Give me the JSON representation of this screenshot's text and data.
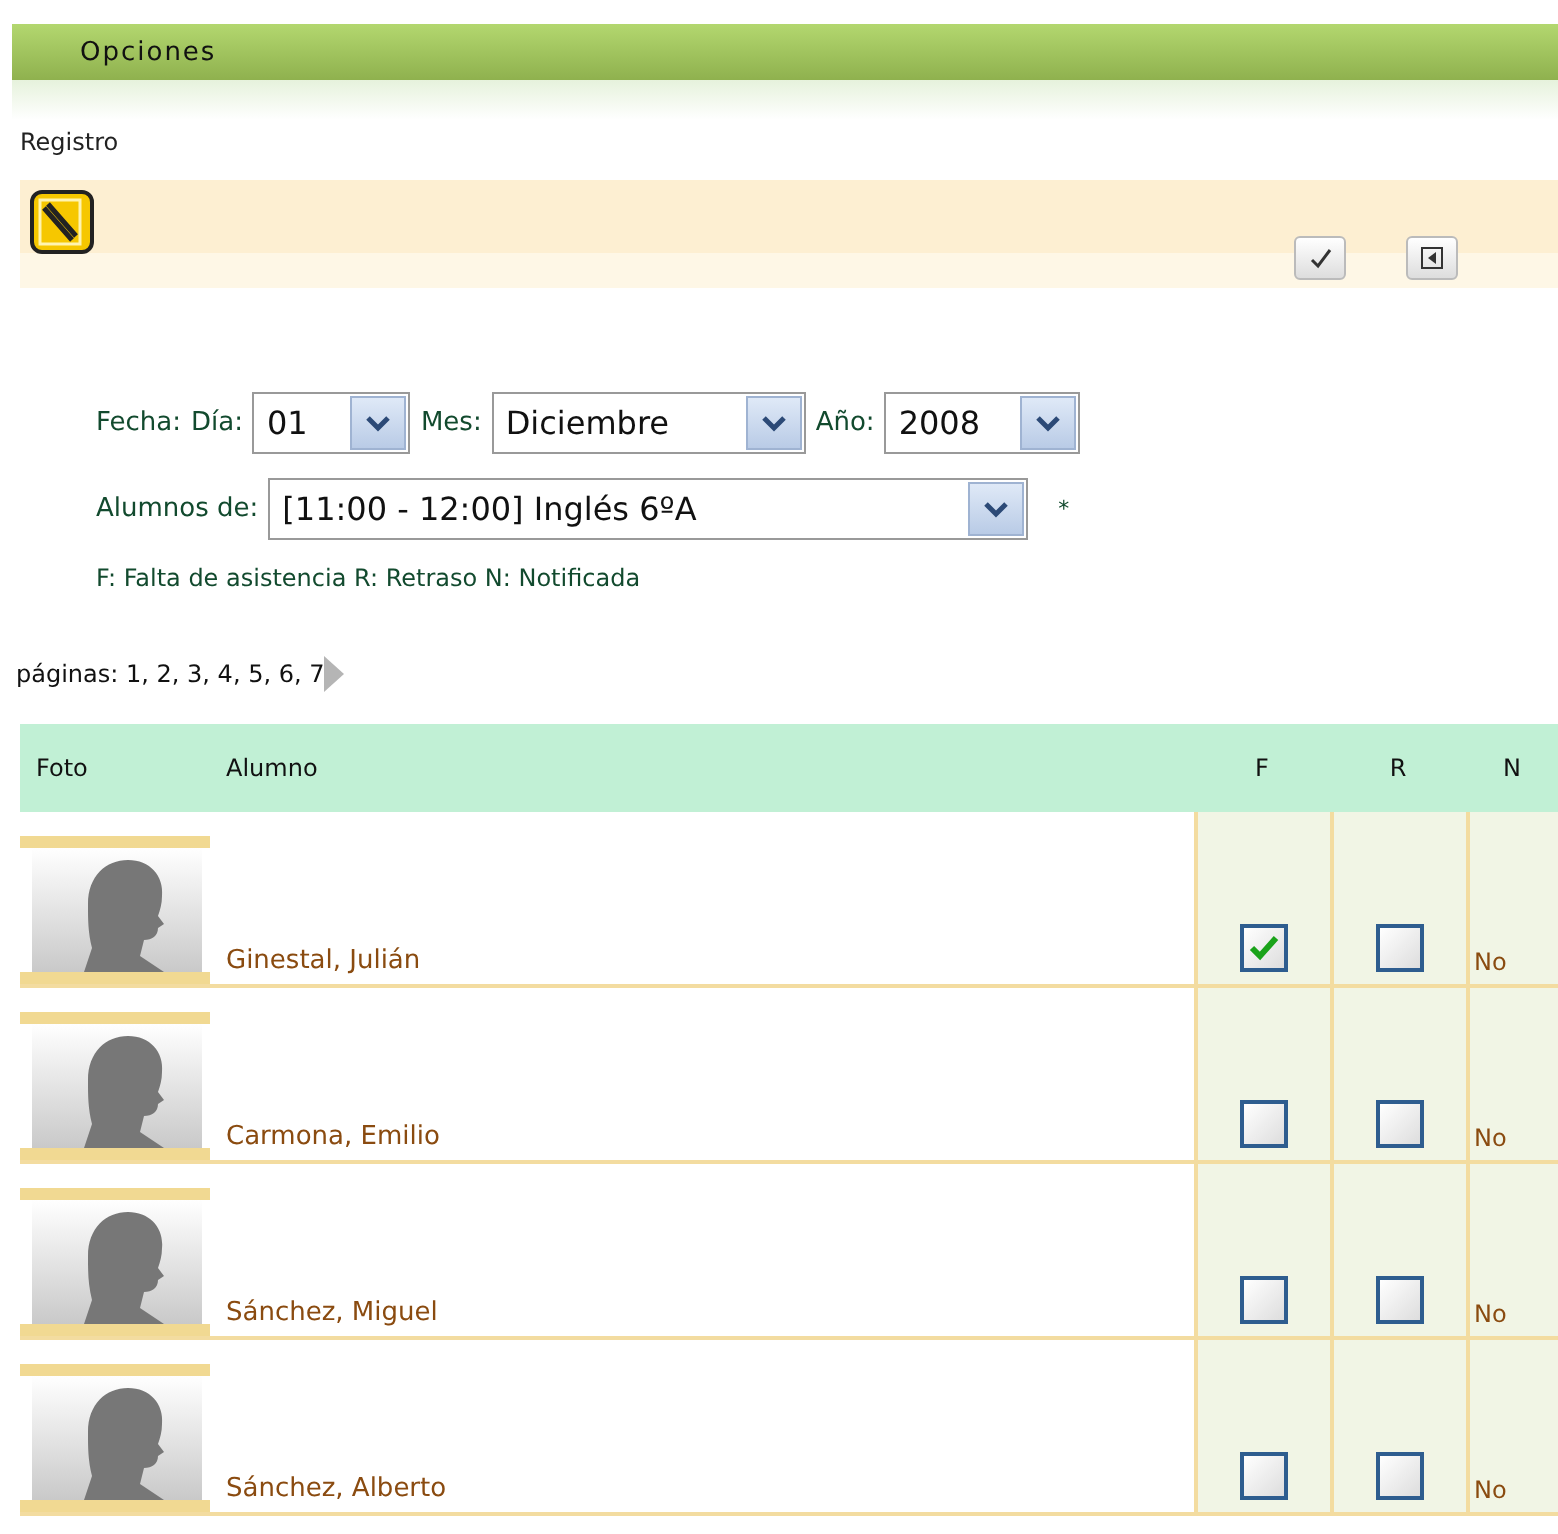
{
  "header": {
    "title": "Opciones"
  },
  "section": "Registro",
  "form": {
    "date_label": "Fecha:",
    "day_label": "Día:",
    "day": "01",
    "month_label": "Mes:",
    "month": "Diciembre",
    "year_label": "Año:",
    "year": "2008",
    "students_label": "Alumnos de:",
    "students": "[11:00 - 12:00] Inglés 6ºA",
    "required_mark": "*",
    "legend": "F: Falta de asistencia R: Retraso N: Notificada"
  },
  "pagination": {
    "label": "páginas:",
    "pages": "1, 2, 3, 4, 5, 6, 7"
  },
  "table": {
    "columns": [
      "Foto",
      "Alumno",
      "F",
      "R",
      "N"
    ],
    "rows": [
      {
        "name": "Ginestal, Julián",
        "absent": true,
        "late": false,
        "notified": "No"
      },
      {
        "name": "Carmona, Emilio",
        "absent": false,
        "late": false,
        "notified": "No"
      },
      {
        "name": "Sánchez, Miguel",
        "absent": false,
        "late": false,
        "notified": "No"
      },
      {
        "name": "Sánchez, Alberto",
        "absent": false,
        "late": false,
        "notified": "No"
      }
    ]
  }
}
